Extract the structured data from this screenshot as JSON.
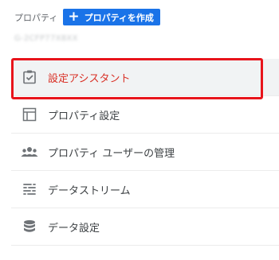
{
  "header": {
    "label": "プロパティ",
    "create_button": {
      "icon": "plus-icon",
      "label": "プロパティを作成"
    }
  },
  "property_id": "G-2CFP77X8XX",
  "nav": {
    "items": [
      {
        "label": "設定アシスタント",
        "icon": "checklist-icon",
        "active": true
      },
      {
        "label": "プロパティ設定",
        "icon": "layout-icon",
        "active": false
      },
      {
        "label": "プロパティ ユーザーの管理",
        "icon": "people-icon",
        "active": false
      },
      {
        "label": "データストリーム",
        "icon": "stream-icon",
        "active": false
      },
      {
        "label": "データ設定",
        "icon": "database-icon",
        "active": false
      }
    ]
  },
  "colors": {
    "accent": "#1a73e8",
    "highlight_border": "#e8141b",
    "active_text": "#d93025"
  }
}
